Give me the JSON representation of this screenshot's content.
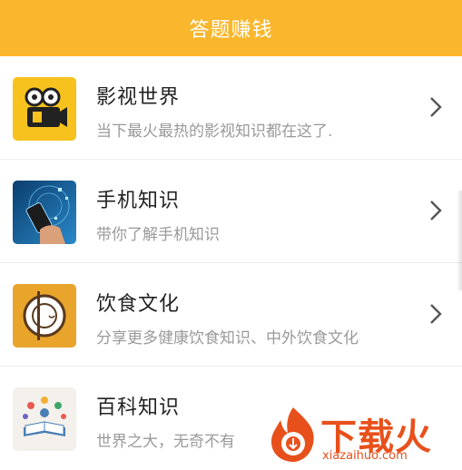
{
  "header": {
    "title": "答题赚钱"
  },
  "list": {
    "items": [
      {
        "title": "影视世界",
        "subtitle": "当下最火最热的影视知识都在这了.",
        "icon": "movie-camera-icon"
      },
      {
        "title": "手机知识",
        "subtitle": "带你了解手机知识",
        "icon": "phone-tech-icon"
      },
      {
        "title": "饮食文化",
        "subtitle": "分享更多健康饮食知识、中外饮食文化",
        "icon": "plate-icon"
      },
      {
        "title": "百科知识",
        "subtitle": "世界之大，无奇不有",
        "icon": "encyclopedia-icon"
      }
    ]
  },
  "watermark": {
    "brand": "下载火",
    "url": "xiazaihuo.com"
  },
  "colors": {
    "accent": "#FAB62C",
    "watermark": "#E8501B"
  }
}
